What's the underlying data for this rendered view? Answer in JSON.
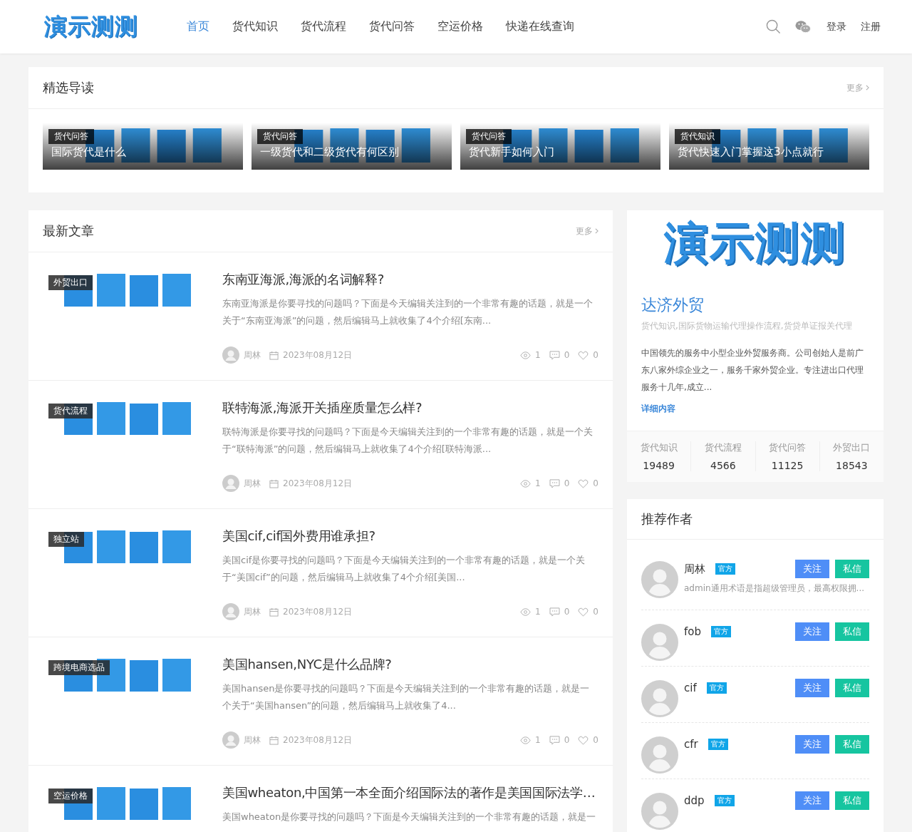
{
  "header": {
    "logo": "演示测测",
    "nav": [
      {
        "label": "首页",
        "selected": true
      },
      {
        "label": "货代知识",
        "selected": false
      },
      {
        "label": "货代流程",
        "selected": false
      },
      {
        "label": "货代问答",
        "selected": false
      },
      {
        "label": "空运价格",
        "selected": false
      },
      {
        "label": "快递在线查询",
        "selected": false
      }
    ],
    "actions": [
      "登录",
      "注册"
    ]
  },
  "featured": {
    "title": "精选导读",
    "more": "更多",
    "items": [
      {
        "tag": "货代问答",
        "title": "国际货代是什么"
      },
      {
        "tag": "货代问答",
        "title": "一级货代和二级货代有何区别"
      },
      {
        "tag": "货代问答",
        "title": "货代新手如何入门"
      },
      {
        "tag": "货代知识",
        "title": "货代快速入门掌握这3小点就行"
      }
    ]
  },
  "latest": {
    "title": "最新文章",
    "more": "更多",
    "articles": [
      {
        "tag": "外贸出口",
        "title": "东南亚海派,海派的名词解释?",
        "excerpt": "东南亚海派是你要寻找的问题吗？下面是今天编辑关注到的一个非常有趣的话题，就是一个关于“东南亚海派”的问题，然后编辑马上就收集了4个介绍[东南...",
        "author": "周林",
        "date": "2023年08月12日",
        "views": "1",
        "comments": "0",
        "likes": "0"
      },
      {
        "tag": "货代流程",
        "title": "联特海派,海派开关插座质量怎么样?",
        "excerpt": "联特海派是你要寻找的问题吗？下面是今天编辑关注到的一个非常有趣的话题，就是一个关于“联特海派”的问题，然后编辑马上就收集了4个介绍[联特海派...",
        "author": "周林",
        "date": "2023年08月12日",
        "views": "1",
        "comments": "0",
        "likes": "0"
      },
      {
        "tag": "独立站",
        "title": "美国cif,cif国外费用谁承担?",
        "excerpt": "美国cif是你要寻找的问题吗？下面是今天编辑关注到的一个非常有趣的话题，就是一个关于“美国cif”的问题，然后编辑马上就收集了4个介绍[美国...",
        "author": "周林",
        "date": "2023年08月12日",
        "views": "1",
        "comments": "0",
        "likes": "0"
      },
      {
        "tag": "跨境电商选品",
        "title": "美国hansen,NYC是什么品牌?",
        "excerpt": "美国hansen是你要寻找的问题吗？下面是今天编辑关注到的一个非常有趣的话题，就是一个关于“美国hansen”的问题，然后编辑马上就收集了4...",
        "author": "周林",
        "date": "2023年08月12日",
        "views": "1",
        "comments": "0",
        "likes": "0"
      },
      {
        "tag": "空运价格",
        "title": "美国wheaton,中国第一本全面介绍国际法的著作是美国国际法学…",
        "excerpt": "美国wheaton是你要寻找的问题吗？下面是今天编辑关注到的一个非常有趣的话题，就是一"
      }
    ]
  },
  "about": {
    "logo": "演示测测",
    "name": "达济外贸",
    "subtitle": "货代知识,国际货物运输代理操作流程,货贷单证报关代理",
    "description": "中国领先的服务中小型企业外贸服务商。公司创始人是前广东八家外综企业之一，服务千家外贸企业。专注进出口代理服务十几年,成立...",
    "link": "详细内容",
    "stats": [
      {
        "label": "货代知识",
        "value": "19489"
      },
      {
        "label": "货代流程",
        "value": "4566"
      },
      {
        "label": "货代问答",
        "value": "11125"
      },
      {
        "label": "外贸出口",
        "value": "18543"
      }
    ]
  },
  "authors": {
    "title": "推荐作者",
    "items": [
      {
        "name": "周林",
        "badge": "官方",
        "bio": "admin通用术语是指超级管理员，最高权限拥...",
        "follow": "关注",
        "message": "私信"
      },
      {
        "name": "fob",
        "badge": "官方",
        "follow": "关注",
        "message": "私信"
      },
      {
        "name": "cif",
        "badge": "官方",
        "follow": "关注",
        "message": "私信"
      },
      {
        "name": "cfr",
        "badge": "官方",
        "follow": "关注",
        "message": "私信"
      },
      {
        "name": "ddp",
        "badge": "官方",
        "follow": "关注",
        "message": "私信"
      }
    ]
  }
}
